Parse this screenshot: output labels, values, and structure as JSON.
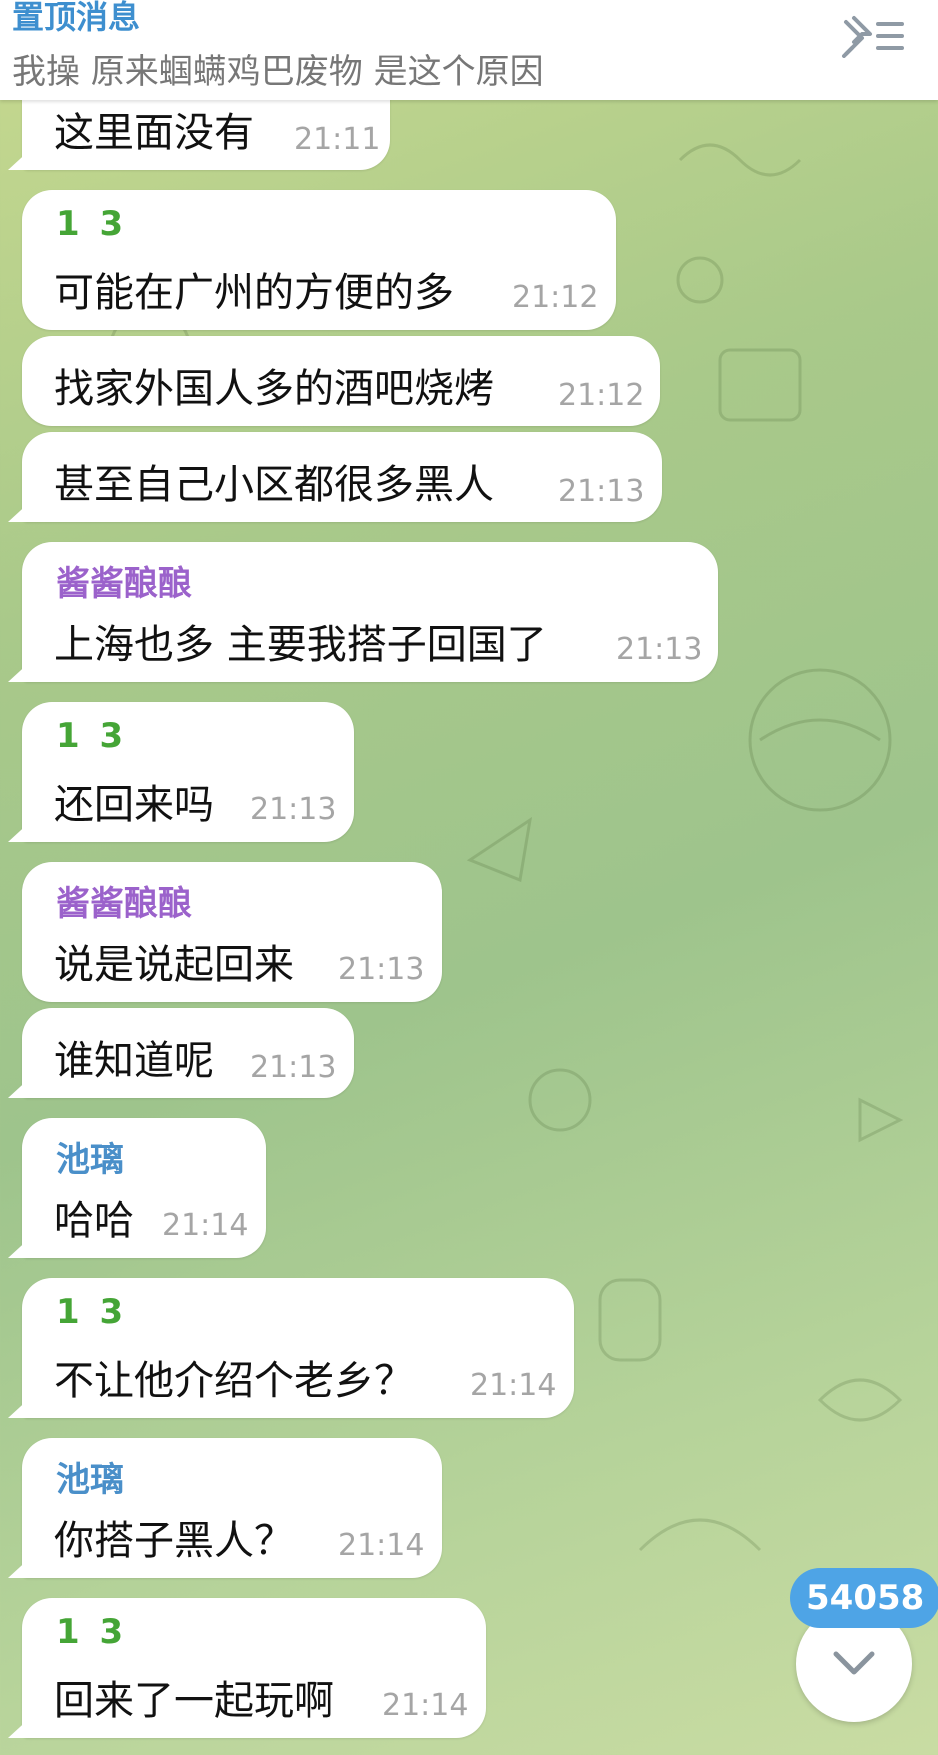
{
  "pinned": {
    "title": "置顶消息",
    "text": "我操 原来蝈螨鸡巴废物 是这个原因",
    "icon": "pin-list-icon"
  },
  "messages": [
    {
      "sender": "",
      "text": "这里面没有",
      "time": "21:11"
    },
    {
      "sender": "1 3",
      "text": "可能在广州的方便的多",
      "time": "21:12"
    },
    {
      "sender": "",
      "text": "找家外国人多的酒吧烧烤",
      "time": "21:12"
    },
    {
      "sender": "",
      "text": "甚至自己小区都很多黑人",
      "time": "21:13"
    },
    {
      "sender": "酱酱酿酿",
      "text": "上海也多 主要我搭子回国了",
      "time": "21:13"
    },
    {
      "sender": "1 3",
      "text": "还回来吗",
      "time": "21:13"
    },
    {
      "sender": "酱酱酿酿",
      "text": "说是说起回来",
      "time": "21:13"
    },
    {
      "sender": "",
      "text": "谁知道呢",
      "time": "21:13"
    },
    {
      "sender": "池璃",
      "text": "哈哈",
      "time": "21:14"
    },
    {
      "sender": "1 3",
      "text": "不让他介绍个老乡？",
      "time": "21:14"
    },
    {
      "sender": "池璃",
      "text": "你搭子黑人？",
      "time": "21:14"
    },
    {
      "sender": "1 3",
      "text": "回来了一起玩啊",
      "time": "21:14"
    }
  ],
  "scroll": {
    "unread_count": "54058",
    "icon": "chevron-down-icon"
  },
  "colors": {
    "sender_13": "#45a536",
    "sender_jiang": "#9b62cb",
    "sender_chili": "#4a8fc9",
    "pinned_title": "#3e8fcf",
    "badge": "#4ea4e6"
  }
}
